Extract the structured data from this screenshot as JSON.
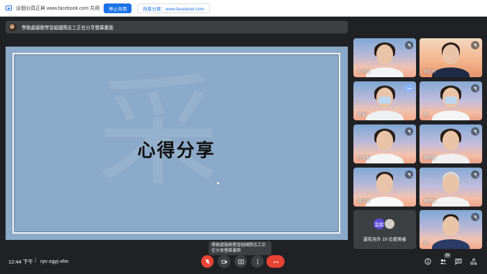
{
  "share_bar": {
    "status_text": "這個分頁正與 www.facebook.com 共用",
    "stop_label": "停止共用",
    "switch_label": "改看分頁：www.facebook.com"
  },
  "presenter": {
    "text": "學務處服務學習組國際志工正在分享螢幕畫面"
  },
  "slide": {
    "title": "心得分享",
    "watermark": "采"
  },
  "participants": [
    {
      "name": "王仔苗",
      "state": "mic-off"
    },
    {
      "name": "劉芷吟",
      "state": "mic-off"
    },
    {
      "name": "黃瑜",
      "state": "more"
    },
    {
      "name": "彤",
      "state": "mic-off"
    },
    {
      "name": "許清惟",
      "state": "mic-off"
    },
    {
      "name": "錢郁維",
      "state": "mic-off"
    },
    {
      "name": "鍾孟妤",
      "state": "mic-off"
    },
    {
      "name": "蔡雨辰",
      "state": "mic-off"
    },
    {
      "name": "你",
      "state": "mic-off"
    }
  ],
  "others": {
    "avatar_label": "宜庭",
    "text": "還有另外 19 位使用者"
  },
  "tooltip": {
    "text": "學務處服務學習組國際志工正在分享螢幕畫面"
  },
  "bottom": {
    "time": "12:44 下午",
    "separator": "|",
    "meeting_code": "ryc-zgyj-xhn",
    "people_count": "29"
  },
  "colors": {
    "accent": "#1a73e8",
    "danger": "#ea4335",
    "background": "#202124",
    "stage": "#8ba9c8"
  },
  "icons": [
    "share-screen-icon",
    "mic-off-icon",
    "camera-icon",
    "present-icon",
    "more-vert-icon",
    "hangup-icon",
    "info-icon",
    "people-icon",
    "chat-icon",
    "activities-icon"
  ]
}
